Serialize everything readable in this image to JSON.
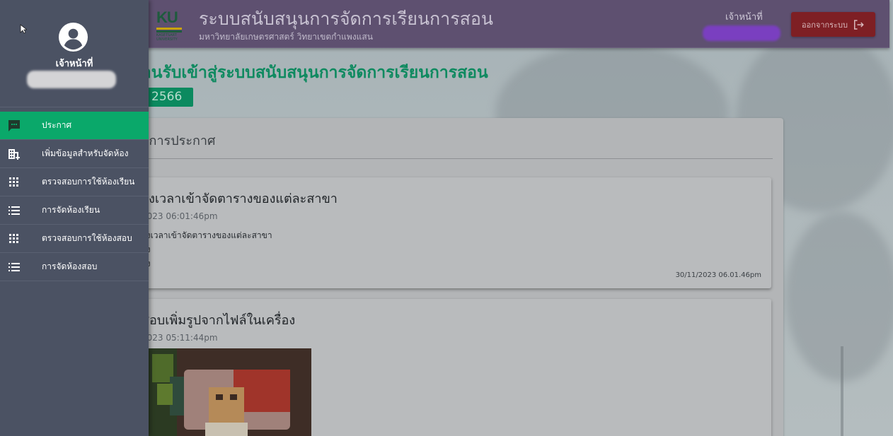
{
  "topbar": {
    "logo_text": "KU",
    "logo_small": "KASETSART UNIVERSITY",
    "title": "ระบบสนับสนุนการจัดการเรียนการสอน",
    "subtitle": "มหาวิทยาลัยเกษตรศาสตร์ วิทยาเขตกำแพงแสน",
    "role": "เจ้าหน้าที่",
    "logout_label": "ออกจากระบบ"
  },
  "main": {
    "welcome": "ต้อนรับเข้าสู่ระบบสนับสนุนการจัดการเรียนการสอน",
    "year": "น 2566",
    "announcements_heading": "ยการประกาศ",
    "posts": [
      {
        "title": "างเวลาเข้าจัดตารางของแต่ละสาขา",
        "date": "2023 06:01:46pm",
        "body": [
          "างเวลาเข้าจัดตารางของแต่ละสาขา",
          "าง",
          "าง"
        ],
        "footer": "30/11/2023 06.01.46pm"
      },
      {
        "title": "สอบเพิ่มรูปจากไฟล์ในเครื่อง",
        "date": "2023 05:11:44pm"
      }
    ]
  },
  "drawer": {
    "role": "เจ้าหน้าที่",
    "menu": [
      {
        "label": "ประกาศ",
        "icon": "chat-icon",
        "active": true
      },
      {
        "label": "เพิ่มข้อมูลสำหรับจัดห้อง",
        "icon": "building-add-icon",
        "active": false
      },
      {
        "label": "ตรวจสอบการใช้ห้องเรียน",
        "icon": "grid-icon",
        "active": false
      },
      {
        "label": "การจัดห้องเรียน",
        "icon": "list-icon",
        "active": false
      },
      {
        "label": "ตรวจสอบการใช้ห้องสอบ",
        "icon": "grid-icon",
        "active": false
      },
      {
        "label": "การจัดห้องสอบ",
        "icon": "list-icon",
        "active": false
      }
    ]
  },
  "colors": {
    "topbar": "#5e5070",
    "drawer": "#4b5263",
    "active_menu": "#0aa86a",
    "logout": "#7e1f24",
    "welcome_text": "#0f8a60"
  }
}
